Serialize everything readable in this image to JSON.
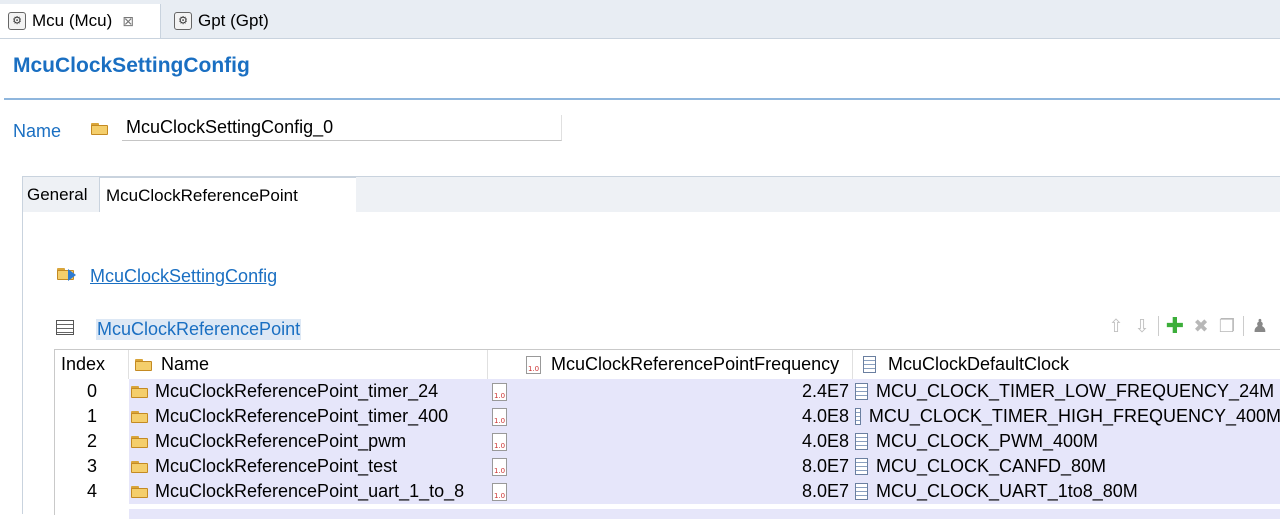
{
  "editor_tabs": [
    {
      "label": "Mcu (Mcu)",
      "close": "⊠"
    },
    {
      "label": "Gpt (Gpt)"
    }
  ],
  "page": {
    "title": "McuClockSettingConfig"
  },
  "name_field": {
    "label": "Name",
    "value": "McuClockSettingConfig_0"
  },
  "inner_tabs": [
    {
      "label": "General"
    },
    {
      "label": "McuClockReferencePoint"
    }
  ],
  "link": {
    "label": "McuClockSettingConfig"
  },
  "section": {
    "label": "McuClockReferencePoint"
  },
  "table": {
    "columns": [
      "Index",
      "Name",
      "McuClockReferencePointFrequency",
      "McuClockDefaultClock"
    ],
    "rows": [
      {
        "index": "0",
        "name": "McuClockReferencePoint_timer_24",
        "frequency": "2.4E7",
        "clock": "MCU_CLOCK_TIMER_LOW_FREQUENCY_24M"
      },
      {
        "index": "1",
        "name": "McuClockReferencePoint_timer_400",
        "frequency": "4.0E8",
        "clock": "MCU_CLOCK_TIMER_HIGH_FREQUENCY_400M"
      },
      {
        "index": "2",
        "name": "McuClockReferencePoint_pwm",
        "frequency": "4.0E8",
        "clock": "MCU_CLOCK_PWM_400M"
      },
      {
        "index": "3",
        "name": "McuClockReferencePoint_test",
        "frequency": "8.0E7",
        "clock": "MCU_CLOCK_CANFD_80M"
      },
      {
        "index": "4",
        "name": "McuClockReferencePoint_uart_1_to_8",
        "frequency": "8.0E7",
        "clock": "MCU_CLOCK_UART_1to8_80M"
      }
    ]
  },
  "icons": {
    "editor_tab": "settings-icon",
    "folder": "folder-icon",
    "frequency": "numeric-field-icon",
    "clock": "document-icon",
    "toolbar": [
      "move-up-icon",
      "move-down-icon",
      "add-icon",
      "delete-icon",
      "copy-icon",
      "user-add-icon"
    ]
  },
  "colors": {
    "accent": "#1a6fc2",
    "row_highlight": "#e6e6fa",
    "add": "#3cae3a"
  }
}
